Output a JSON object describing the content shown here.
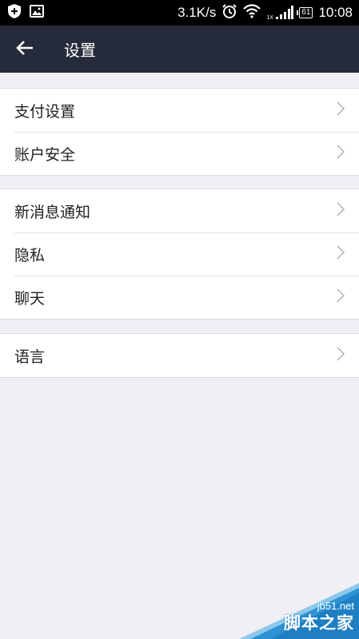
{
  "status_bar": {
    "icons": [
      "shield-icon",
      "image-icon",
      "alarm-icon",
      "wifi-icon",
      "signal-icon",
      "battery-icon"
    ],
    "speed": "3.1K/s",
    "battery": "61",
    "signal_label": "1X",
    "time": "10:08"
  },
  "header": {
    "back_icon": "arrow-left-icon",
    "title": "设置"
  },
  "groups": [
    {
      "items": [
        {
          "label": "支付设置"
        },
        {
          "label": "账户安全"
        }
      ]
    },
    {
      "items": [
        {
          "label": "新消息通知"
        },
        {
          "label": "隐私"
        },
        {
          "label": "聊天"
        }
      ]
    },
    {
      "items": [
        {
          "label": "语言"
        }
      ]
    }
  ],
  "watermark": {
    "site": "jb51.net",
    "name": "脚本之家"
  },
  "colors": {
    "header_bg": "#252b3a",
    "page_bg": "#efeff4",
    "watermark_bg": "#2e93d4"
  }
}
